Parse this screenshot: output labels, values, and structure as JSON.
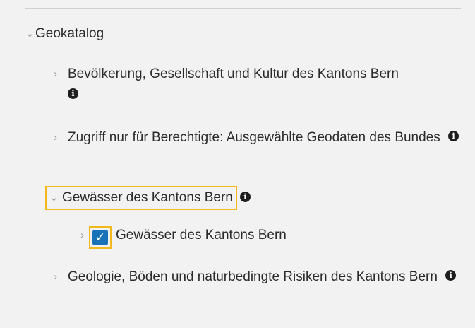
{
  "tree": {
    "root": {
      "label": "Geokatalog",
      "expanded": true
    },
    "items": [
      {
        "label": "Bevölkerung, Gesellschaft und Kultur des Kantons Bern",
        "expanded": false,
        "has_info": true
      },
      {
        "label": "Zugriff nur für Berechtigte: Ausgewählte Geodaten des Bundes",
        "expanded": false,
        "has_info": true
      },
      {
        "label": "Gewässer des Kantons Bern",
        "expanded": true,
        "has_info": true,
        "highlighted": true,
        "children": [
          {
            "label": "Gewässer des Kantons Bern",
            "checked": true,
            "highlighted": true
          }
        ]
      },
      {
        "label": "Geologie, Böden und naturbedingte Risiken des Kantons Bern",
        "expanded": false,
        "has_info": true
      }
    ]
  },
  "icons": {
    "collapsed": "chevron-right-icon",
    "expanded": "chevron-down-icon",
    "info": "info-icon",
    "checked": "checkmark-icon"
  },
  "colors": {
    "background": "#f2f2f2",
    "highlight": "#f2b81d",
    "checkbox": "#1a73b8",
    "chevron": "#9a9a9a"
  }
}
